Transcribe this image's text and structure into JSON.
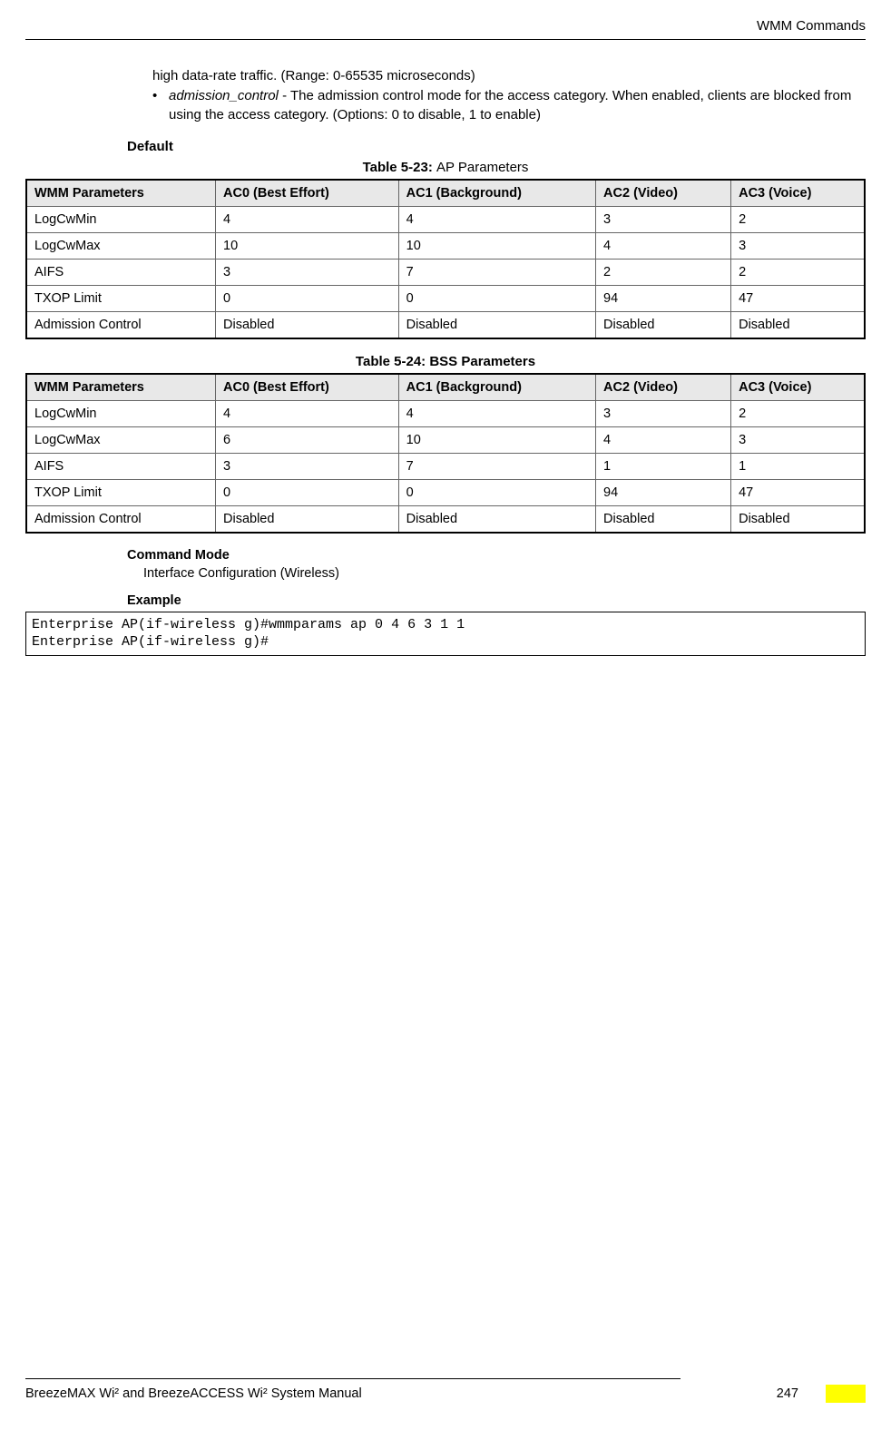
{
  "header": {
    "title": "WMM Commands"
  },
  "intro": {
    "line1": "high data-rate traffic. (Range: 0-65535 microseconds)",
    "bullet_term": "admission_control",
    "bullet_rest": " - The admission control mode for the access category. When enabled, clients are blocked from using the access category. (Options: 0 to disable, 1 to enable)"
  },
  "default_heading": "Default",
  "table23": {
    "caption_bold": "Table 5-23: ",
    "caption_rest": "AP Parameters",
    "headers": [
      "WMM Parameters",
      "AC0 (Best Effort)",
      "AC1 (Background)",
      "AC2 (Video)",
      "AC3 (Voice)"
    ],
    "rows": [
      [
        "LogCwMin",
        "4",
        "4",
        "3",
        "2"
      ],
      [
        "LogCwMax",
        "10",
        "10",
        "4",
        "3"
      ],
      [
        "AIFS",
        "3",
        "7",
        "2",
        "2"
      ],
      [
        "TXOP Limit",
        "0",
        "0",
        "94",
        "47"
      ],
      [
        "Admission Control",
        "Disabled",
        "Disabled",
        "Disabled",
        "Disabled"
      ]
    ]
  },
  "table24": {
    "caption": "Table 5-24: BSS Parameters",
    "headers": [
      "WMM Parameters",
      "AC0 (Best Effort)",
      "AC1 (Background)",
      "AC2 (Video)",
      "AC3 (Voice)"
    ],
    "rows": [
      [
        "LogCwMin",
        "4",
        "4",
        "3",
        "2"
      ],
      [
        "LogCwMax",
        "6",
        "10",
        "4",
        "3"
      ],
      [
        "AIFS",
        "3",
        "7",
        "1",
        "1"
      ],
      [
        "TXOP Limit",
        "0",
        "0",
        "94",
        "47"
      ],
      [
        "Admission Control",
        "Disabled",
        "Disabled",
        "Disabled",
        "Disabled"
      ]
    ]
  },
  "command_mode": {
    "heading": "Command Mode",
    "body": "Interface Configuration (Wireless)"
  },
  "example": {
    "heading": "Example",
    "line1": "Enterprise AP(if-wireless g)#wmmparams ap 0 4 6 3 1 1",
    "line2": "Enterprise AP(if-wireless g)#"
  },
  "footer": {
    "manual": "BreezeMAX Wi² and BreezeACCESS Wi² System Manual",
    "page": "247"
  }
}
